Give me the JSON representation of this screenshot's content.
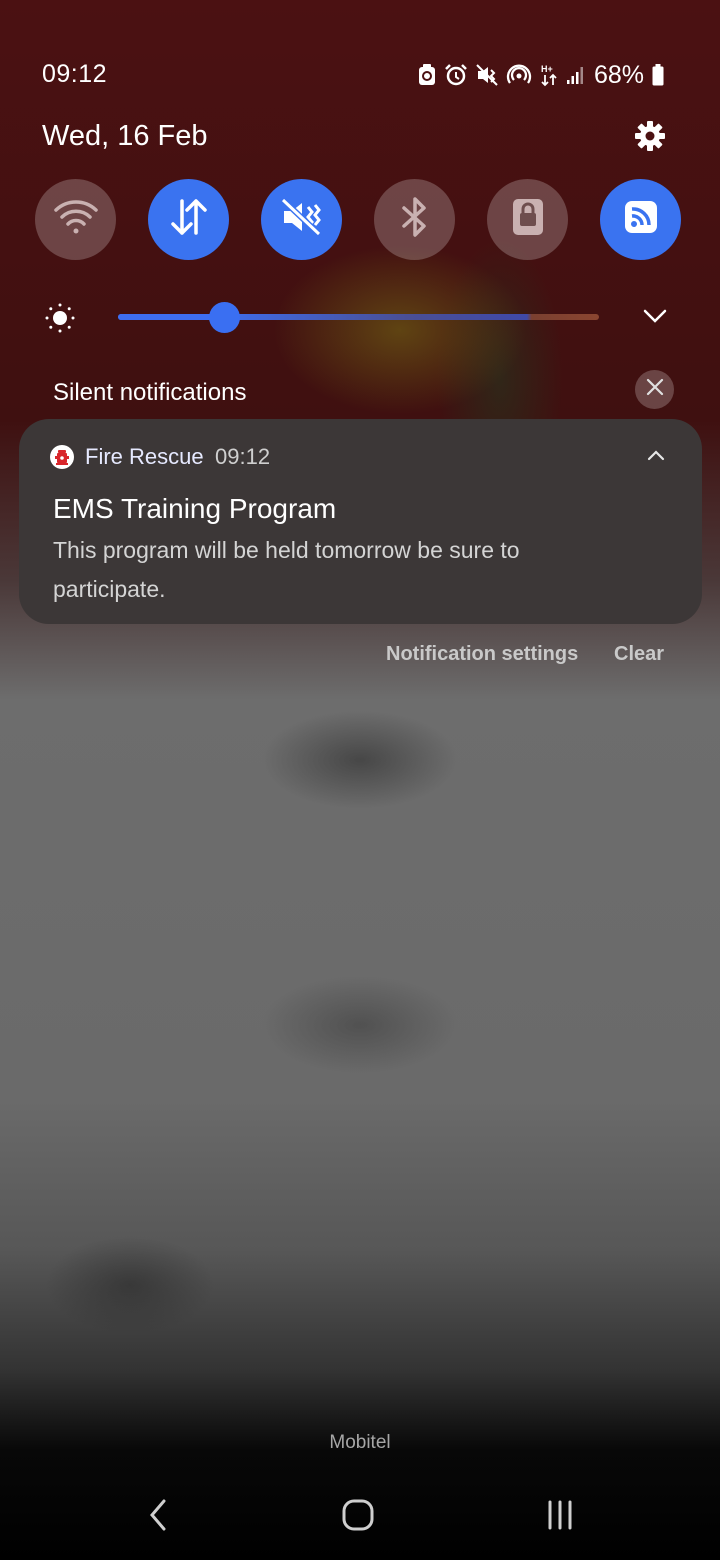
{
  "status_bar": {
    "time": "09:12",
    "battery_percent": "68%",
    "icons": [
      "usb-debug-icon",
      "alarm-icon",
      "vibrate-icon",
      "hotspot-icon",
      "data-arrows-icon",
      "signal-icon",
      "battery-icon"
    ]
  },
  "header": {
    "date": "Wed, 16 Feb",
    "settings_icon": "gear-icon"
  },
  "quick_tiles": [
    {
      "name": "Wi-Fi",
      "icon": "wifi-icon",
      "state": "off"
    },
    {
      "name": "Mobile data",
      "icon": "data-transfer-icon",
      "state": "on"
    },
    {
      "name": "Mute",
      "icon": "mute-icon",
      "state": "on"
    },
    {
      "name": "Bluetooth",
      "icon": "bluetooth-icon",
      "state": "off"
    },
    {
      "name": "Screen lock",
      "icon": "lock-icon",
      "state": "off"
    },
    {
      "name": "Cast",
      "icon": "cast-icon",
      "state": "on"
    }
  ],
  "brightness": {
    "level": 0.22
  },
  "notifications": {
    "section_title": "Silent notifications",
    "items": [
      {
        "app": "Fire Rescue",
        "time": "09:12",
        "title": "EMS Training Program",
        "body": "This program will be held tomorrow be sure to participate."
      }
    ],
    "settings_label": "Notification settings",
    "clear_label": "Clear"
  },
  "carrier": "Mobitel",
  "colors": {
    "accent": "#3a73f0",
    "panel_top": "#4b1112",
    "card": "#3c3737"
  }
}
